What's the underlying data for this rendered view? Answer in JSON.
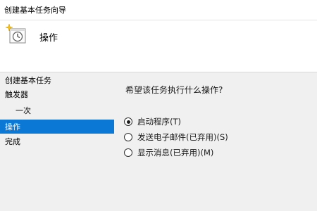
{
  "window": {
    "title": "创建基本任务向导"
  },
  "header": {
    "title": "操作",
    "icon": "clock-task-icon"
  },
  "nav": {
    "items": [
      {
        "label": "创建基本任务",
        "sub": false,
        "active": false
      },
      {
        "label": "触发器",
        "sub": false,
        "active": false
      },
      {
        "label": "一次",
        "sub": true,
        "active": false
      },
      {
        "label": "操作",
        "sub": false,
        "active": true
      },
      {
        "label": "完成",
        "sub": false,
        "active": false
      }
    ]
  },
  "content": {
    "prompt": "希望该任务执行什么操作?",
    "options": [
      {
        "label": "启动程序(T)",
        "checked": true
      },
      {
        "label": "发送电子邮件(已弃用)(S)",
        "checked": false
      },
      {
        "label": "显示消息(已弃用)(M)",
        "checked": false
      }
    ]
  },
  "colors": {
    "accent": "#0a78d4",
    "background": "#f0f0f0"
  }
}
